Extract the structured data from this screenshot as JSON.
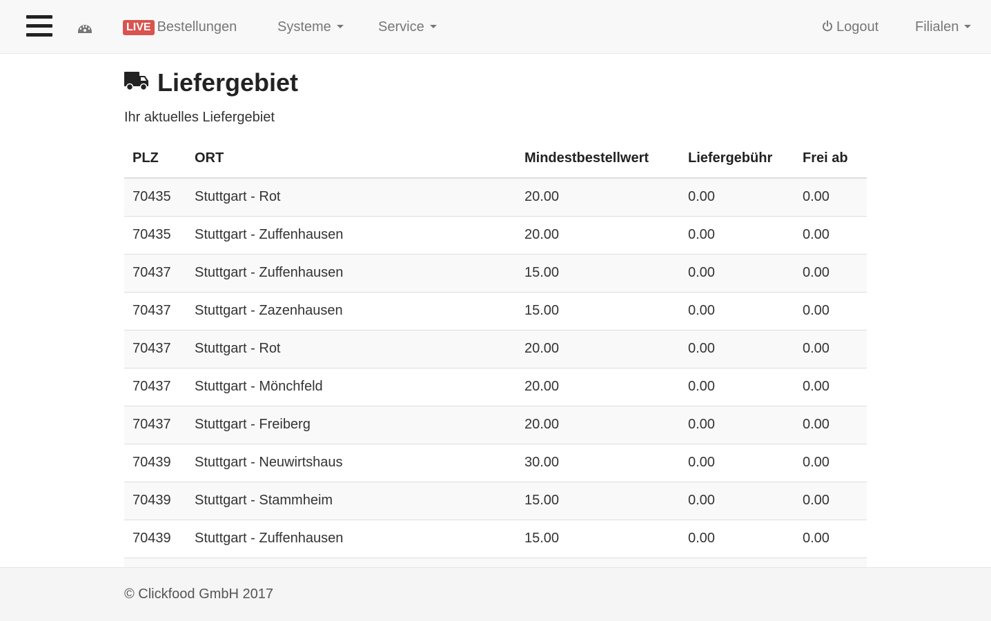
{
  "navbar": {
    "live_badge": "LIVE",
    "orders_label": "Bestellungen",
    "systems_label": "Systeme",
    "service_label": "Service",
    "logout_label": "Logout",
    "branches_label": "Filialen"
  },
  "page": {
    "title": "Liefergebiet",
    "subtitle": "Ihr aktuelles Liefergebiet"
  },
  "table": {
    "headers": [
      "PLZ",
      "ORT",
      "Mindestbestellwert",
      "Liefergebühr",
      "Frei ab"
    ],
    "rows": [
      [
        "70435",
        "Stuttgart - Rot",
        "20.00",
        "0.00",
        "0.00"
      ],
      [
        "70435",
        "Stuttgart - Zuffenhausen",
        "20.00",
        "0.00",
        "0.00"
      ],
      [
        "70437",
        "Stuttgart - Zuffenhausen",
        "15.00",
        "0.00",
        "0.00"
      ],
      [
        "70437",
        "Stuttgart - Zazenhausen",
        "15.00",
        "0.00",
        "0.00"
      ],
      [
        "70437",
        "Stuttgart - Rot",
        "20.00",
        "0.00",
        "0.00"
      ],
      [
        "70437",
        "Stuttgart - Mönchfeld",
        "20.00",
        "0.00",
        "0.00"
      ],
      [
        "70437",
        "Stuttgart - Freiberg",
        "20.00",
        "0.00",
        "0.00"
      ],
      [
        "70439",
        "Stuttgart - Neuwirtshaus",
        "30.00",
        "0.00",
        "0.00"
      ],
      [
        "70439",
        "Stuttgart - Stammheim",
        "15.00",
        "0.00",
        "0.00"
      ],
      [
        "70439",
        "Stuttgart - Zuffenhausen",
        "15.00",
        "0.00",
        "0.00"
      ],
      [
        "",
        "",
        "",
        "",
        ""
      ]
    ]
  },
  "footer": {
    "copyright": "© Clickfood GmbH 2017"
  },
  "colors": {
    "live_badge": "#d9534f",
    "navbar_bg": "#f8f8f8",
    "footer_bg": "#f5f5f5",
    "stripe": "#f9f9f9"
  },
  "icons": {
    "menu": "hamburger-menu-icon",
    "home": "dashboard-icon",
    "logout": "power-icon",
    "title": "truck-icon"
  }
}
